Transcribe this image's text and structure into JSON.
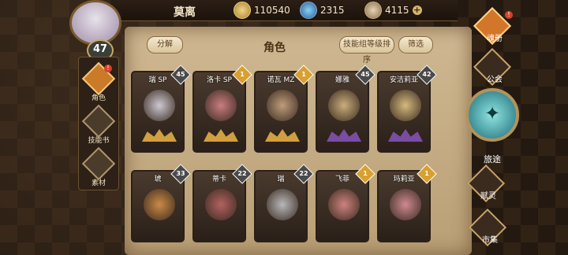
{
  "player": {
    "name": "莫离",
    "level": "47"
  },
  "resources": [
    {
      "icon": "gold-coin-icon",
      "value": "110540"
    },
    {
      "icon": "blue-crystal-icon",
      "value": "2315"
    },
    {
      "icon": "stone-icon",
      "value": "4115"
    }
  ],
  "left_nav": [
    {
      "label": "角色",
      "icon": "character-icon",
      "active": true,
      "badge": "!"
    },
    {
      "label": "技能书",
      "icon": "skill-book-icon",
      "active": false
    },
    {
      "label": "素材",
      "icon": "material-icon",
      "active": false
    }
  ],
  "panel": {
    "title": "角色",
    "decompose_label": "分解",
    "sort_label": "技能组等级排序",
    "filter_label": "筛选"
  },
  "cards": [
    {
      "name": "瑞 SP",
      "level": "45",
      "tier": "gold"
    },
    {
      "name": "洛卡 SP",
      "level": "1",
      "tier": "gold"
    },
    {
      "name": "诺瓦 MZ",
      "level": "1",
      "tier": "gold"
    },
    {
      "name": "娜雅",
      "level": "45",
      "tier": "purple"
    },
    {
      "name": "安洁莉亚",
      "level": "42",
      "tier": "purple"
    },
    {
      "name": "琥",
      "level": "33",
      "tier": "gold"
    },
    {
      "name": "蒂卡",
      "level": "22",
      "tier": "gold"
    },
    {
      "name": "瑞",
      "level": "22",
      "tier": "gold"
    },
    {
      "name": "飞菲",
      "level": "1",
      "tier": "gold"
    },
    {
      "name": "玛莉亚",
      "level": "1",
      "tier": "gold"
    }
  ],
  "right_nav": [
    {
      "label": "魂册",
      "icon": "soul-book-icon",
      "active": true,
      "badge": "!"
    },
    {
      "label": "公会",
      "icon": "guild-icon",
      "active": false
    },
    {
      "label": "旅途",
      "icon": "journey-icon",
      "active": false
    },
    {
      "label": "赋灵",
      "icon": "empower-icon",
      "active": false
    },
    {
      "label": "市集",
      "icon": "market-icon",
      "active": false
    }
  ],
  "colors": {
    "gold": "#d0a040",
    "purple": "#7b4ca3",
    "accent": "#d2772a"
  }
}
